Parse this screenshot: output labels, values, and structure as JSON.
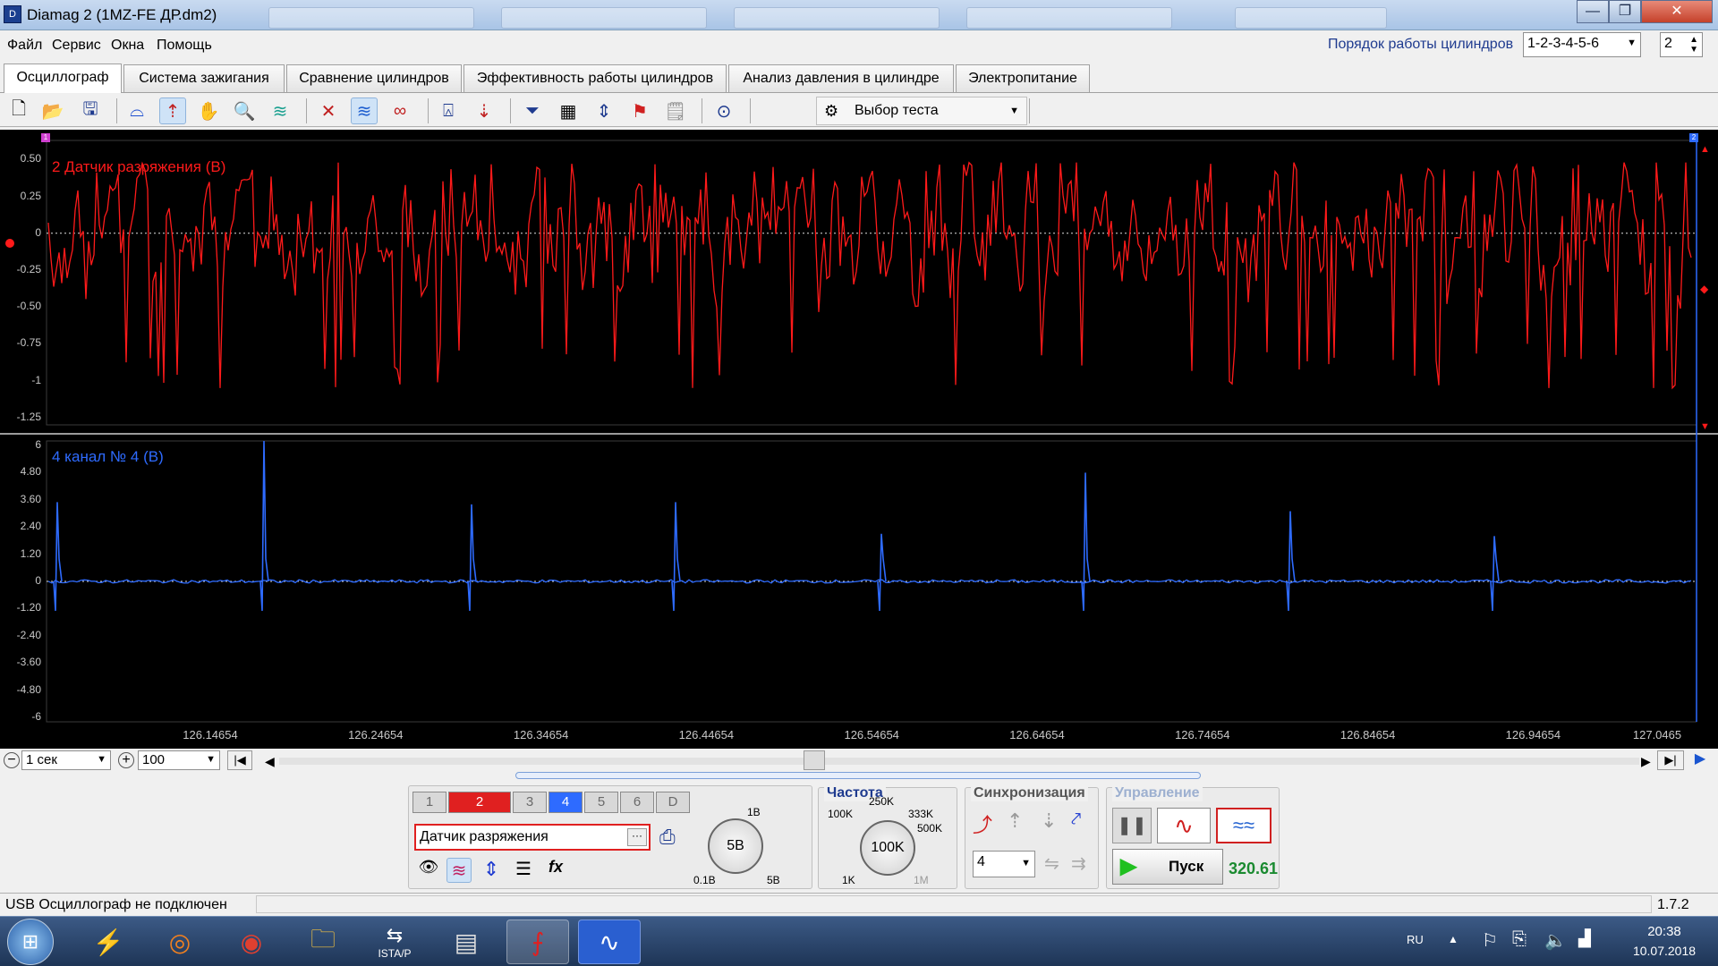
{
  "window": {
    "title": "Diamag 2 (1MZ-FE ДР.dm2)",
    "icon": "D",
    "minimize": "—",
    "maximize": "❐",
    "close": "✕"
  },
  "menu": {
    "items": [
      "Файл",
      "Сервис",
      "Окна",
      "Помощь"
    ]
  },
  "cylinder_order": {
    "label": "Порядок работы цилиндров",
    "value": "1-2-3-4-5-6",
    "count": "2"
  },
  "tabs": [
    {
      "label": "Осциллограф",
      "active": true
    },
    {
      "label": "Система зажигания"
    },
    {
      "label": "Сравнение цилиндров"
    },
    {
      "label": "Эффективность работы цилиндров"
    },
    {
      "label": "Анализ давления в цилиндре"
    },
    {
      "label": "Электропитание"
    }
  ],
  "toolbar": {
    "icons": [
      "new-file-icon",
      "open-folder-icon",
      "save-icon",
      "cursor-tool-icon",
      "measure-tool-icon",
      "hand-tool-icon",
      "zoom-icon",
      "waveform-tool-icon",
      "compress-icon",
      "expand-icon",
      "cross-icon",
      "auto-scale-icon",
      "zero-offset-icon",
      "filter-icon",
      "grid-icon",
      "split-icon",
      "flag-icon",
      "notes-icon",
      "auto-v-icon"
    ],
    "test_select": "Выбор теста"
  },
  "scope": {
    "channel2": {
      "label": "2 Датчик разряжения (В)",
      "color": "#ff1a1a",
      "ticks": [
        "0.50",
        "0.25",
        "0",
        "-0.25",
        "-0.50",
        "-0.75",
        "-1",
        "-1.25"
      ]
    },
    "channel4": {
      "label": "4  канал № 4 (В)",
      "color": "#2e6bff",
      "ticks": [
        "6",
        "4.80",
        "3.60",
        "2.40",
        "1.20",
        "0",
        "-1.20",
        "-2.40",
        "-3.60",
        "-4.80",
        "-6"
      ]
    },
    "x_ticks": [
      "126.14654",
      "126.24654",
      "126.34654",
      "126.44654",
      "126.54654",
      "126.64654",
      "126.74654",
      "126.84654",
      "126.94654",
      "127.0465"
    ],
    "marker_left": "1",
    "marker_right": "2"
  },
  "timebase": {
    "value": "1 сек",
    "zoom": "100"
  },
  "channels": {
    "buttons": [
      "1",
      "2",
      "3",
      "4",
      "5",
      "6",
      "D"
    ],
    "active": [
      "2",
      "4"
    ],
    "sensor": "Датчик разряжения",
    "sensor_btn": "···"
  },
  "volts_knob": {
    "value": "5B",
    "min": "0.1В",
    "max": "5В",
    "top": "1В"
  },
  "frequency": {
    "title": "Частота",
    "value": "100K",
    "labels": [
      "250K",
      "333K",
      "500K",
      "100K",
      "1K",
      "1M"
    ]
  },
  "sync": {
    "title": "Синхронизация",
    "channel": "4"
  },
  "control": {
    "title": "Управление",
    "start": "Пуск",
    "time": "320.61"
  },
  "status": {
    "text": "USB Осциллограф не подключен",
    "version": "1.7.2"
  },
  "tray": {
    "lang": "RU",
    "time": "20:38",
    "date": "10.07.2018"
  },
  "taskbar": {
    "items": [
      "windows-start",
      "diamag-logo-app",
      "orbit-app",
      "chrome",
      "file-explorer",
      "istap-app",
      "calculator",
      "pdf-reader",
      "diamag-scope"
    ],
    "istap_label": "ISTA/P"
  }
}
